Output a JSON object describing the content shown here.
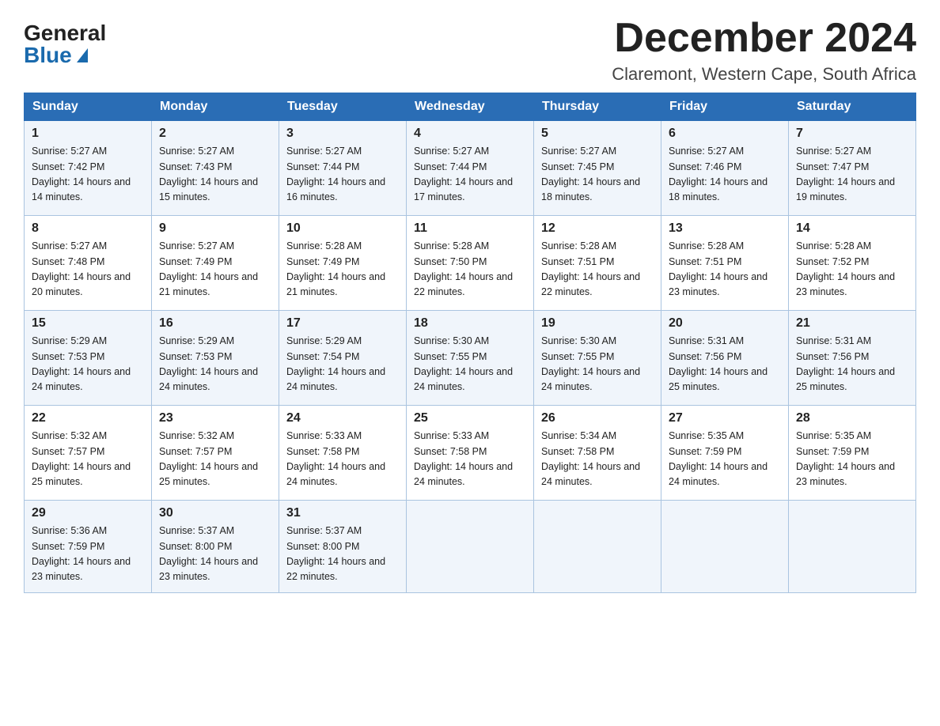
{
  "header": {
    "logo_general": "General",
    "logo_blue": "Blue",
    "month_title": "December 2024",
    "location": "Claremont, Western Cape, South Africa"
  },
  "weekdays": [
    "Sunday",
    "Monday",
    "Tuesday",
    "Wednesday",
    "Thursday",
    "Friday",
    "Saturday"
  ],
  "weeks": [
    [
      {
        "day": "1",
        "sunrise": "Sunrise: 5:27 AM",
        "sunset": "Sunset: 7:42 PM",
        "daylight": "Daylight: 14 hours and 14 minutes."
      },
      {
        "day": "2",
        "sunrise": "Sunrise: 5:27 AM",
        "sunset": "Sunset: 7:43 PM",
        "daylight": "Daylight: 14 hours and 15 minutes."
      },
      {
        "day": "3",
        "sunrise": "Sunrise: 5:27 AM",
        "sunset": "Sunset: 7:44 PM",
        "daylight": "Daylight: 14 hours and 16 minutes."
      },
      {
        "day": "4",
        "sunrise": "Sunrise: 5:27 AM",
        "sunset": "Sunset: 7:44 PM",
        "daylight": "Daylight: 14 hours and 17 minutes."
      },
      {
        "day": "5",
        "sunrise": "Sunrise: 5:27 AM",
        "sunset": "Sunset: 7:45 PM",
        "daylight": "Daylight: 14 hours and 18 minutes."
      },
      {
        "day": "6",
        "sunrise": "Sunrise: 5:27 AM",
        "sunset": "Sunset: 7:46 PM",
        "daylight": "Daylight: 14 hours and 18 minutes."
      },
      {
        "day": "7",
        "sunrise": "Sunrise: 5:27 AM",
        "sunset": "Sunset: 7:47 PM",
        "daylight": "Daylight: 14 hours and 19 minutes."
      }
    ],
    [
      {
        "day": "8",
        "sunrise": "Sunrise: 5:27 AM",
        "sunset": "Sunset: 7:48 PM",
        "daylight": "Daylight: 14 hours and 20 minutes."
      },
      {
        "day": "9",
        "sunrise": "Sunrise: 5:27 AM",
        "sunset": "Sunset: 7:49 PM",
        "daylight": "Daylight: 14 hours and 21 minutes."
      },
      {
        "day": "10",
        "sunrise": "Sunrise: 5:28 AM",
        "sunset": "Sunset: 7:49 PM",
        "daylight": "Daylight: 14 hours and 21 minutes."
      },
      {
        "day": "11",
        "sunrise": "Sunrise: 5:28 AM",
        "sunset": "Sunset: 7:50 PM",
        "daylight": "Daylight: 14 hours and 22 minutes."
      },
      {
        "day": "12",
        "sunrise": "Sunrise: 5:28 AM",
        "sunset": "Sunset: 7:51 PM",
        "daylight": "Daylight: 14 hours and 22 minutes."
      },
      {
        "day": "13",
        "sunrise": "Sunrise: 5:28 AM",
        "sunset": "Sunset: 7:51 PM",
        "daylight": "Daylight: 14 hours and 23 minutes."
      },
      {
        "day": "14",
        "sunrise": "Sunrise: 5:28 AM",
        "sunset": "Sunset: 7:52 PM",
        "daylight": "Daylight: 14 hours and 23 minutes."
      }
    ],
    [
      {
        "day": "15",
        "sunrise": "Sunrise: 5:29 AM",
        "sunset": "Sunset: 7:53 PM",
        "daylight": "Daylight: 14 hours and 24 minutes."
      },
      {
        "day": "16",
        "sunrise": "Sunrise: 5:29 AM",
        "sunset": "Sunset: 7:53 PM",
        "daylight": "Daylight: 14 hours and 24 minutes."
      },
      {
        "day": "17",
        "sunrise": "Sunrise: 5:29 AM",
        "sunset": "Sunset: 7:54 PM",
        "daylight": "Daylight: 14 hours and 24 minutes."
      },
      {
        "day": "18",
        "sunrise": "Sunrise: 5:30 AM",
        "sunset": "Sunset: 7:55 PM",
        "daylight": "Daylight: 14 hours and 24 minutes."
      },
      {
        "day": "19",
        "sunrise": "Sunrise: 5:30 AM",
        "sunset": "Sunset: 7:55 PM",
        "daylight": "Daylight: 14 hours and 24 minutes."
      },
      {
        "day": "20",
        "sunrise": "Sunrise: 5:31 AM",
        "sunset": "Sunset: 7:56 PM",
        "daylight": "Daylight: 14 hours and 25 minutes."
      },
      {
        "day": "21",
        "sunrise": "Sunrise: 5:31 AM",
        "sunset": "Sunset: 7:56 PM",
        "daylight": "Daylight: 14 hours and 25 minutes."
      }
    ],
    [
      {
        "day": "22",
        "sunrise": "Sunrise: 5:32 AM",
        "sunset": "Sunset: 7:57 PM",
        "daylight": "Daylight: 14 hours and 25 minutes."
      },
      {
        "day": "23",
        "sunrise": "Sunrise: 5:32 AM",
        "sunset": "Sunset: 7:57 PM",
        "daylight": "Daylight: 14 hours and 25 minutes."
      },
      {
        "day": "24",
        "sunrise": "Sunrise: 5:33 AM",
        "sunset": "Sunset: 7:58 PM",
        "daylight": "Daylight: 14 hours and 24 minutes."
      },
      {
        "day": "25",
        "sunrise": "Sunrise: 5:33 AM",
        "sunset": "Sunset: 7:58 PM",
        "daylight": "Daylight: 14 hours and 24 minutes."
      },
      {
        "day": "26",
        "sunrise": "Sunrise: 5:34 AM",
        "sunset": "Sunset: 7:58 PM",
        "daylight": "Daylight: 14 hours and 24 minutes."
      },
      {
        "day": "27",
        "sunrise": "Sunrise: 5:35 AM",
        "sunset": "Sunset: 7:59 PM",
        "daylight": "Daylight: 14 hours and 24 minutes."
      },
      {
        "day": "28",
        "sunrise": "Sunrise: 5:35 AM",
        "sunset": "Sunset: 7:59 PM",
        "daylight": "Daylight: 14 hours and 23 minutes."
      }
    ],
    [
      {
        "day": "29",
        "sunrise": "Sunrise: 5:36 AM",
        "sunset": "Sunset: 7:59 PM",
        "daylight": "Daylight: 14 hours and 23 minutes."
      },
      {
        "day": "30",
        "sunrise": "Sunrise: 5:37 AM",
        "sunset": "Sunset: 8:00 PM",
        "daylight": "Daylight: 14 hours and 23 minutes."
      },
      {
        "day": "31",
        "sunrise": "Sunrise: 5:37 AM",
        "sunset": "Sunset: 8:00 PM",
        "daylight": "Daylight: 14 hours and 22 minutes."
      },
      null,
      null,
      null,
      null
    ]
  ]
}
